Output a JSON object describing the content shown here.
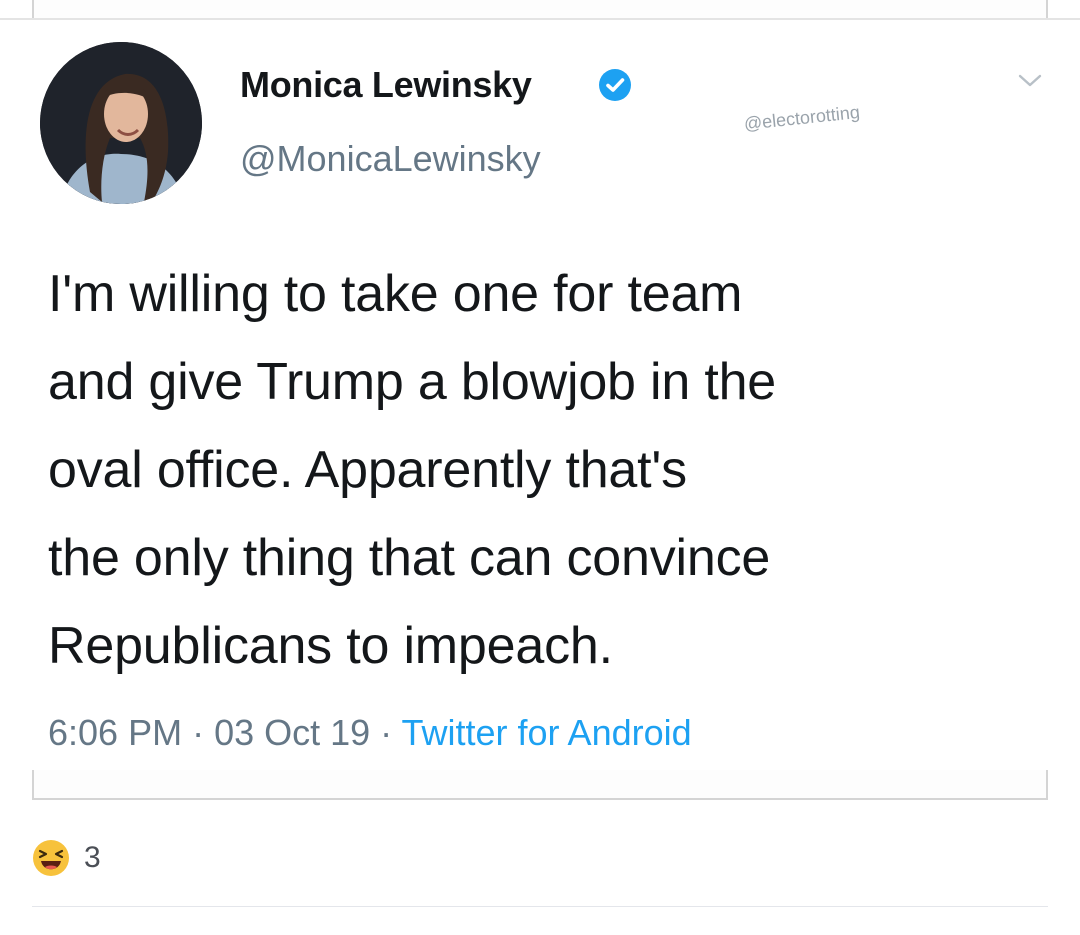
{
  "tweet": {
    "display_name": "Monica Lewinsky",
    "handle": "@MonicaLewinsky",
    "watermark": "@electorotting",
    "text_lines": [
      "I'm willing to take one for team",
      "and give Trump a blowjob in the",
      "oval office. Apparently that's",
      "the only thing that can convince",
      "Republicans to impeach."
    ],
    "time": "6:06 PM",
    "date": "03 Oct 19",
    "separator": " · ",
    "source": "Twitter for Android",
    "icons": {
      "verified": "verified-badge-icon",
      "menu": "chevron-down-icon"
    }
  },
  "reactions": {
    "emoji": "laughing-face-icon",
    "count": "3"
  },
  "colors": {
    "name": "#14171a",
    "secondary": "#657786",
    "link": "#1da1f2",
    "verified": "#1da1f2"
  }
}
